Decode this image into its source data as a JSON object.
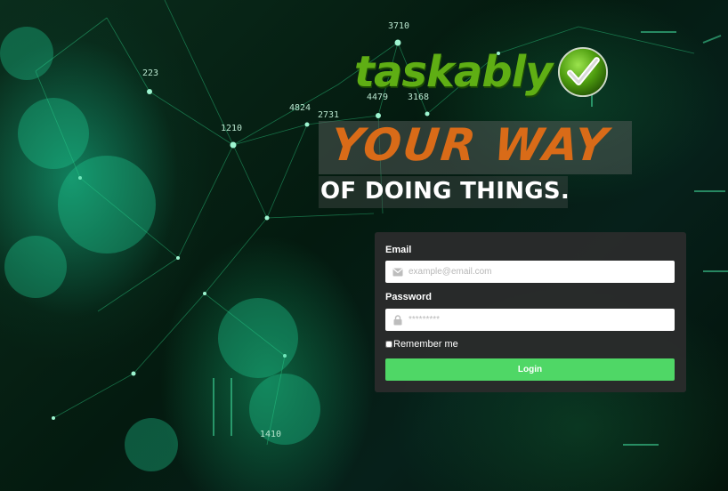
{
  "brand": {
    "name": "taskably",
    "accent_color": "#5fae14",
    "check_icon": "checkmark-badge-icon"
  },
  "tagline": {
    "line1": "YOUR WAY",
    "line2": "OF DOING THINGS.",
    "line1_color": "#d96b18"
  },
  "background": {
    "numbers": [
      "3710",
      "223",
      "4479",
      "3168",
      "4824",
      "2731",
      "1210",
      "1410"
    ]
  },
  "login": {
    "email_label": "Email",
    "email_placeholder": "example@email.com",
    "email_icon": "envelope-icon",
    "password_label": "Password",
    "password_placeholder": "*********",
    "password_icon": "lock-icon",
    "remember_label": "Remember me",
    "remember_checked": false,
    "submit_label": "Login",
    "submit_color": "#4fd766"
  }
}
